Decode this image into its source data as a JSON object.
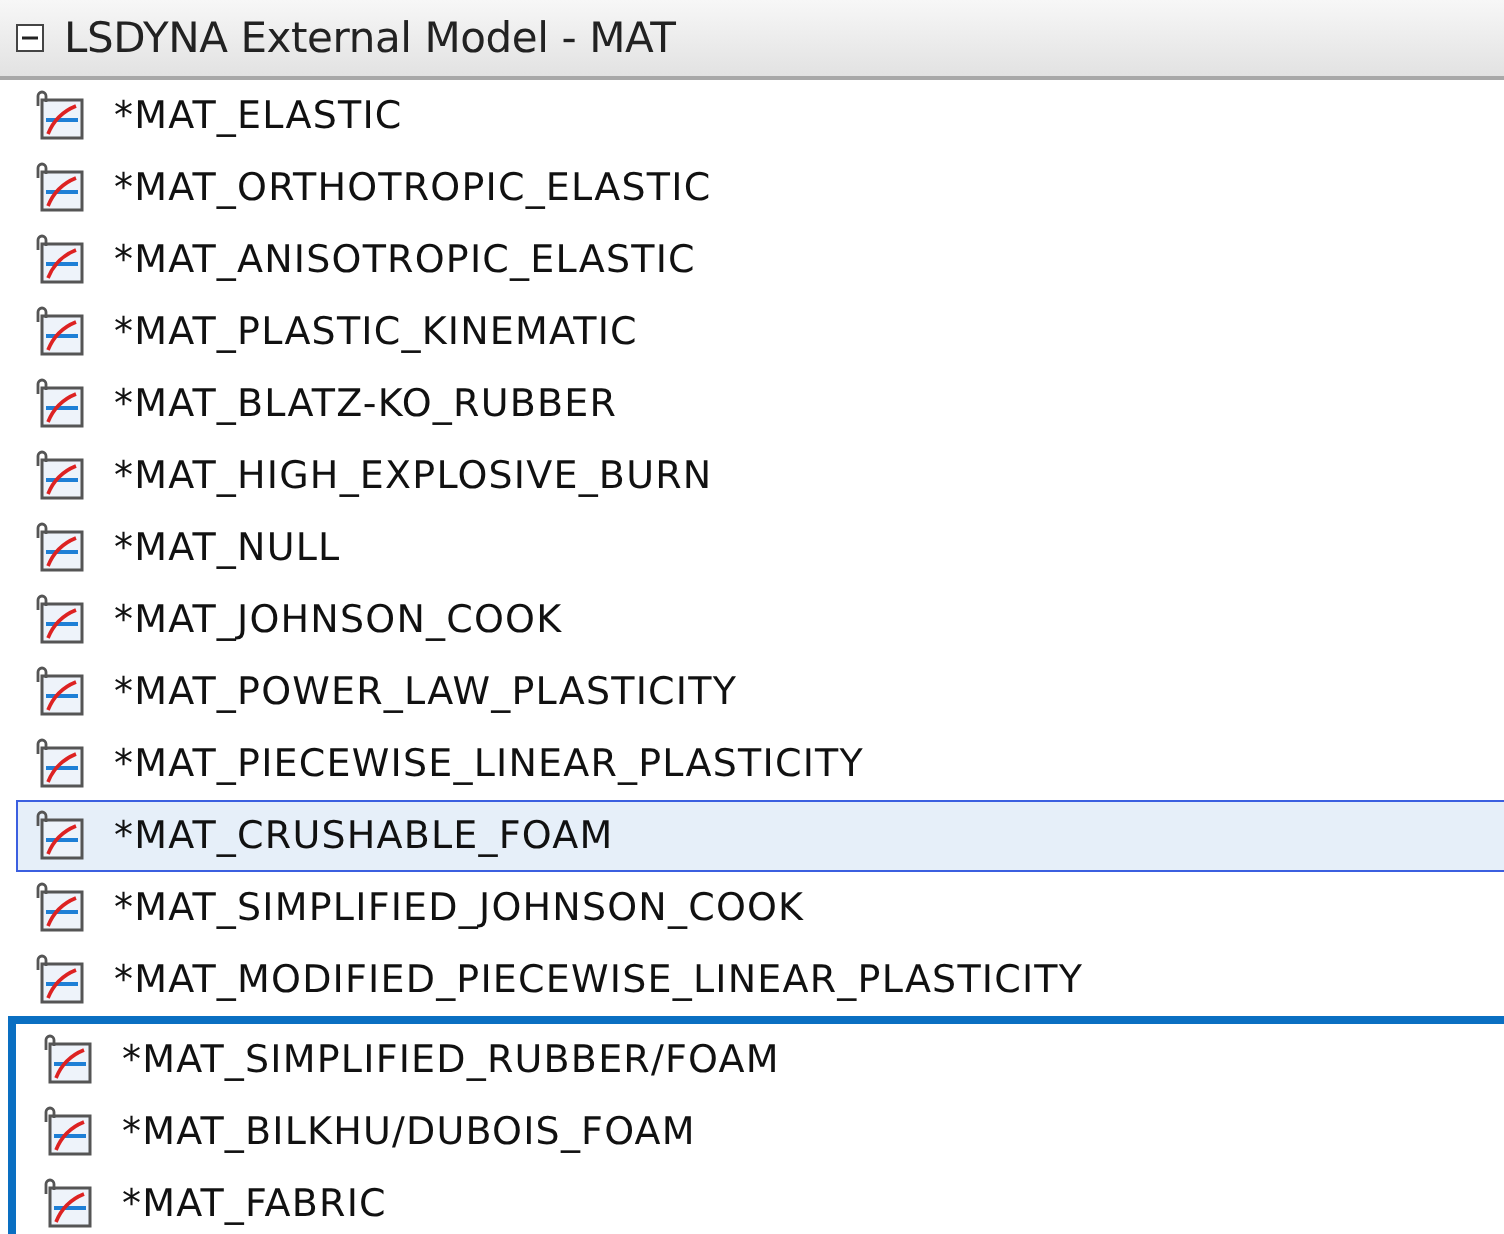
{
  "group": {
    "title": "LSDYNA External Model - MAT",
    "expanded": true
  },
  "items": [
    {
      "label": "*MAT_ELASTIC",
      "selected": false,
      "highlighted": false
    },
    {
      "label": "*MAT_ORTHOTROPIC_ELASTIC",
      "selected": false,
      "highlighted": false
    },
    {
      "label": "*MAT_ANISOTROPIC_ELASTIC",
      "selected": false,
      "highlighted": false
    },
    {
      "label": "*MAT_PLASTIC_KINEMATIC",
      "selected": false,
      "highlighted": false
    },
    {
      "label": "*MAT_BLATZ-KO_RUBBER",
      "selected": false,
      "highlighted": false
    },
    {
      "label": "*MAT_HIGH_EXPLOSIVE_BURN",
      "selected": false,
      "highlighted": false
    },
    {
      "label": "*MAT_NULL",
      "selected": false,
      "highlighted": false
    },
    {
      "label": "*MAT_JOHNSON_COOK",
      "selected": false,
      "highlighted": false
    },
    {
      "label": "*MAT_POWER_LAW_PLASTICITY",
      "selected": false,
      "highlighted": false
    },
    {
      "label": "*MAT_PIECEWISE_LINEAR_PLASTICITY",
      "selected": false,
      "highlighted": false
    },
    {
      "label": "*MAT_CRUSHABLE_FOAM",
      "selected": true,
      "highlighted": false
    },
    {
      "label": "*MAT_SIMPLIFIED_JOHNSON_COOK",
      "selected": false,
      "highlighted": false
    },
    {
      "label": "*MAT_MODIFIED_PIECEWISE_LINEAR_PLASTICITY",
      "selected": false,
      "highlighted": false
    },
    {
      "label": "*MAT_SIMPLIFIED_RUBBER/FOAM",
      "selected": false,
      "highlighted": true
    },
    {
      "label": "*MAT_BILKHU/DUBOIS_FOAM",
      "selected": false,
      "highlighted": true
    },
    {
      "label": "*MAT_FABRIC",
      "selected": false,
      "highlighted": true
    }
  ]
}
